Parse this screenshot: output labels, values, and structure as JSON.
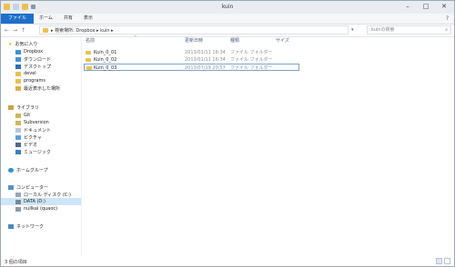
{
  "window": {
    "title": "kuin"
  },
  "ribbon": {
    "tabs": [
      "ファイル",
      "ホーム",
      "共有",
      "表示"
    ],
    "help": "?"
  },
  "address": {
    "path": "▸ 検索場所: Dropbox ▸ kuin ▸",
    "dropdown": "▾",
    "search_placeholder": "kuinの検索",
    "nav_back": "←",
    "nav_forward": "→",
    "nav_up": "↑"
  },
  "sidebar": {
    "favorites_header": "お気に入り",
    "favorites": [
      "Dropbox",
      "ダウンロード",
      "デスクトップ",
      "devel",
      "programs",
      "最近表示した場所"
    ],
    "libraries_header": "ライブラリ",
    "libraries": [
      "Git",
      "Subversion",
      "ドキュメント",
      "ピクチャ",
      "ビデオ",
      "ミュージック"
    ],
    "homegroup": "ホームグループ",
    "computer_header": "コンピューター",
    "drives": [
      "ローカル ディスク (C:)",
      "DATA (D:)",
      "nullkal (quaoc)"
    ],
    "network": "ネットワーク"
  },
  "columns": {
    "name": "名前",
    "modified": "更新日時",
    "type": "種類",
    "size": "サイズ"
  },
  "files": [
    {
      "name": "Kuin_0_01",
      "modified": "2013/01/11 16:34",
      "type": "ファイル フォルダー",
      "selected": false
    },
    {
      "name": "Kuin_0_02",
      "modified": "2013/01/11 16:34",
      "type": "ファイル フォルダー",
      "selected": false
    },
    {
      "name": "Kuin_0_03",
      "modified": "2013/07/19 20:57",
      "type": "ファイル フォルダー",
      "selected": true
    }
  ],
  "status": {
    "text": "3 個の項目"
  },
  "colors": {
    "accent": "#1e6fc9",
    "folder": "#e8c155",
    "selection": "#cde6f7"
  }
}
